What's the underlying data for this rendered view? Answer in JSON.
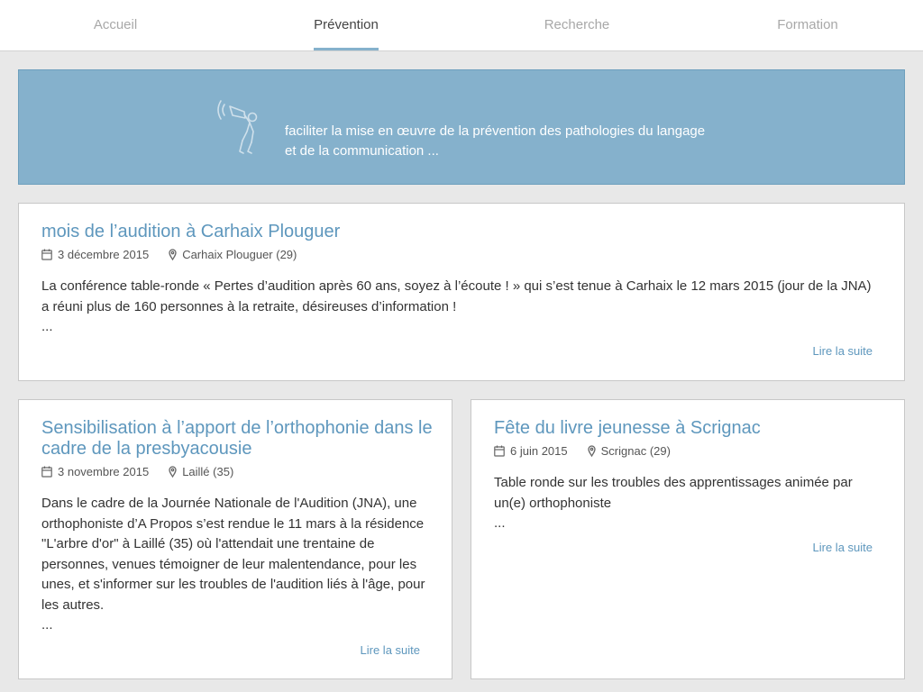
{
  "nav": {
    "tabs": [
      {
        "label": "Accueil"
      },
      {
        "label": "Prévention"
      },
      {
        "label": "Recherche"
      },
      {
        "label": "Formation"
      }
    ]
  },
  "banner": {
    "line1": "faciliter la mise en œuvre de la prévention des pathologies du langage",
    "line2": "et de la communication ..."
  },
  "articles": [
    {
      "title": "mois de l’audition à Carhaix Plouguer",
      "date": "3 décembre 2015",
      "location": "Carhaix Plouguer (29)",
      "excerpt": "La conférence table-ronde « Pertes d’audition après 60 ans, soyez à l’écoute ! » qui s’est tenue à Carhaix le 12 mars 2015 (jour de la JNA) a réuni plus de 160 personnes à la retraite, désireuses d’information !",
      "ellipsis": "...",
      "read_more": "Lire la suite"
    },
    {
      "title": "Sensibilisation à l’apport de l’orthophonie dans le cadre de la presbyacousie",
      "date": "3 novembre 2015",
      "location": "Laillé (35)",
      "excerpt": "Dans le cadre de la Journée Nationale de l'Audition (JNA), une orthophoniste d’A Propos s’est rendue le 11 mars à la résidence \"L'arbre d'or\" à Laillé (35) où l'attendait une trentaine de personnes, venues témoigner de leur malentendance, pour les unes, et s'informer sur les troubles de l'audition liés à l'âge, pour les autres.",
      "ellipsis": "...",
      "read_more": "Lire la suite"
    },
    {
      "title": "Fête du livre jeunesse à Scrignac",
      "date": "6 juin 2015",
      "location": "Scrignac (29)",
      "excerpt": "Table ronde sur les troubles des apprentissages animée par un(e) orthophoniste",
      "ellipsis": "...",
      "read_more": "Lire la suite"
    }
  ]
}
